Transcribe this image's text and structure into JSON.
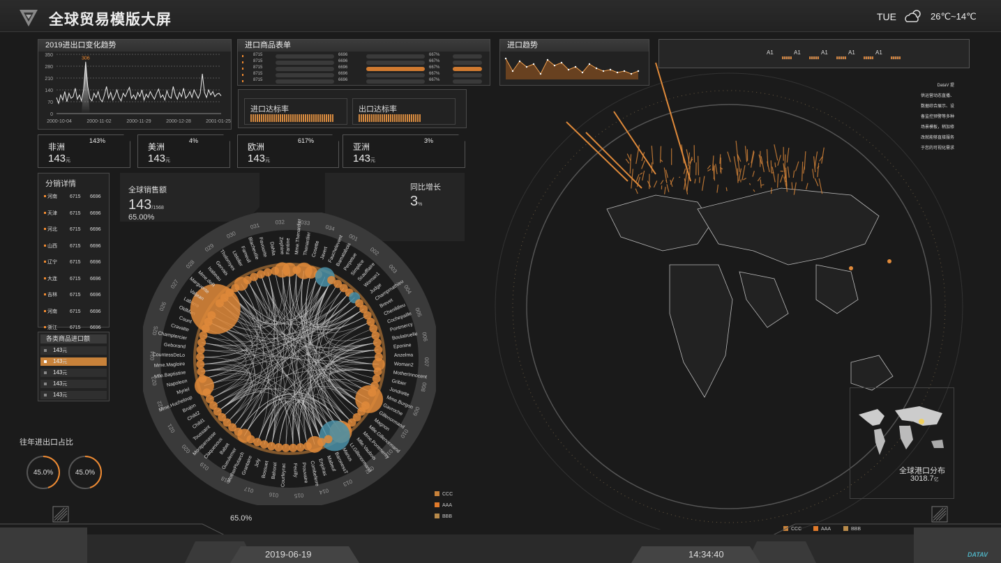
{
  "header": {
    "title": "全球贸易模版大屏",
    "weekday": "TUE",
    "temperature": "26℃~14℃"
  },
  "trend_panel": {
    "title": "2019进出口变化趋势",
    "peak_label": "306",
    "y_ticks": [
      "350",
      "280",
      "210",
      "140",
      "70",
      "0"
    ],
    "x_ticks": [
      "2000-10-04",
      "2000-11-02",
      "2000-11-29",
      "2000-12-28",
      "2001-01-25"
    ]
  },
  "chart_data": {
    "type": "line",
    "title": "2019进出口变化趋势",
    "x": [
      "2000-10-04",
      "2000-11-02",
      "2000-11-29",
      "2000-12-28",
      "2001-01-25"
    ],
    "ylim": [
      0,
      350
    ],
    "series": [
      {
        "values": [
          95,
          60,
          110,
          80,
          130,
          70,
          120,
          90,
          100,
          150,
          85,
          110,
          75,
          140,
          306,
          160,
          90,
          75,
          120,
          95,
          130,
          85,
          70,
          110,
          160,
          90,
          125,
          80,
          105,
          140,
          95,
          75,
          120,
          100,
          130,
          155,
          90,
          110,
          85,
          125,
          100,
          140,
          80,
          115,
          95,
          130,
          105,
          85,
          120,
          145,
          95,
          110,
          80,
          135,
          100,
          90,
          160,
          110,
          85,
          125,
          100,
          150,
          90,
          105,
          130,
          95,
          140,
          115,
          90,
          120,
          235,
          125,
          95,
          140,
          110,
          130,
          100,
          115,
          120,
          105
        ]
      }
    ]
  },
  "import_table": {
    "title": "进口商品表单",
    "rows": [
      {
        "a": "8715",
        "b": "6696",
        "c": "667%"
      },
      {
        "a": "8715",
        "b": "6696",
        "c": "667%"
      },
      {
        "a": "8715",
        "b": "6696",
        "c": "667%"
      },
      {
        "a": "8715",
        "b": "6696",
        "c": "667%"
      },
      {
        "a": "8715",
        "b": "6696",
        "c": "667%"
      }
    ]
  },
  "import_trend": {
    "title": "进口趋势"
  },
  "rates": {
    "import_label": "进口达标率",
    "export_label": "出口达标率"
  },
  "continents": [
    {
      "name": "非洲",
      "pct": "143%",
      "value": "143",
      "unit": "元"
    },
    {
      "name": "美洲",
      "pct": "4%",
      "value": "143",
      "unit": "元"
    },
    {
      "name": "欧洲",
      "pct": "617%",
      "value": "143",
      "unit": "元"
    },
    {
      "name": "亚洲",
      "pct": "3%",
      "value": "143",
      "unit": "元"
    }
  ],
  "distribution": {
    "title": "分销详情",
    "rows": [
      {
        "region": "河南",
        "a": "6715",
        "b": "6696"
      },
      {
        "region": "天津",
        "a": "6715",
        "b": "6696"
      },
      {
        "region": "河北",
        "a": "6715",
        "b": "6696"
      },
      {
        "region": "山西",
        "a": "6715",
        "b": "6696"
      },
      {
        "region": "辽宁",
        "a": "6715",
        "b": "6696"
      },
      {
        "region": "大连",
        "a": "6715",
        "b": "6696"
      },
      {
        "region": "吉林",
        "a": "6715",
        "b": "6696"
      },
      {
        "region": "河南",
        "a": "6715",
        "b": "6696"
      },
      {
        "region": "浙江",
        "a": "6715",
        "b": "6696"
      }
    ]
  },
  "import_amount": {
    "title": "各类商品进口额",
    "items": [
      {
        "value": "143",
        "unit": "元"
      },
      {
        "value": "143",
        "unit": "元"
      },
      {
        "value": "143",
        "unit": "元"
      },
      {
        "value": "143",
        "unit": "元"
      },
      {
        "value": "143",
        "unit": "元"
      }
    ],
    "active_index": 1
  },
  "sales": {
    "label": "全球销售额",
    "value": "143",
    "suffix": "/1568",
    "pct": "65.00%"
  },
  "yoy": {
    "label": "同比增长",
    "value": "3",
    "unit": "%"
  },
  "ratio": {
    "title": "往年进出口占比",
    "left": "45.0%",
    "right": "45.0%",
    "progress": 0.45
  },
  "bottom_pct": "65.0%",
  "chord": {
    "names": [
      "Fantine",
      "Mme.Thenardier",
      "Thenardier",
      "Cosette",
      "Javert",
      "Fauchelevent",
      "Bamatabois",
      "Perpetue",
      "Simplice",
      "Scaufflaire",
      "Woman1",
      "Judge",
      "Champmathieu",
      "Brevet",
      "Chenildieu",
      "Cochepaille",
      "Pontmercy",
      "Boulatruelle",
      "Eponine",
      "Anzelma",
      "Woman2",
      "MotherInnocent",
      "Gribier",
      "Jondrette",
      "Mme.Burgon",
      "Gavroche",
      "Gillenormand",
      "Magnon",
      "Mlle.Gillenormand",
      "Mme.Pontmercy",
      "Mlle.Vaubois",
      "Lt.Gillenormand",
      "Marius",
      "BaronessT",
      "Mabeuf",
      "Enjolras",
      "Combeferre",
      "Prouvaire",
      "Feuilly",
      "Courfeyrac",
      "Bahorel",
      "Bossuet",
      "Joly",
      "Grantaire",
      "MotherPlutarch",
      "Gueulemer",
      "Babet",
      "Claquesous",
      "Montparnasse",
      "Toussaint",
      "Child1",
      "Child2",
      "Brujon",
      "Mme.Hucheloup",
      "Myriel",
      "Napoleon",
      "Mlle.Baptistine",
      "Mme.Magloire",
      "CountessDeLo",
      "Geborand",
      "Champtercier",
      "Cravatte",
      "Count",
      "OldMan",
      "Labarre",
      "Valjean",
      "Marguerite",
      "Mme.deR",
      "Isabeau",
      "Gervais",
      "Tholomyes",
      "Listolier",
      "Fameuil",
      "Blacheville",
      "Favourite",
      "Dahlia",
      "Zephine"
    ],
    "numbers": [
      "001",
      "002",
      "003",
      "004",
      "005",
      "006",
      "007",
      "008",
      "009",
      "010",
      "011",
      "012",
      "013",
      "014",
      "015",
      "016",
      "017",
      "018",
      "019",
      "020",
      "021",
      "022",
      "023",
      "024",
      "025",
      "026",
      "027",
      "028",
      "029",
      "030",
      "031",
      "032",
      "033",
      "034"
    ],
    "legend": [
      {
        "label": "CCC",
        "color": "#c8823a"
      },
      {
        "label": "AAA",
        "color": "#e07a2a"
      },
      {
        "label": "BBB",
        "color": "#b88a4a"
      }
    ]
  },
  "right_info": {
    "a1_labels": [
      "A1",
      "A1",
      "A1",
      "A1",
      "A1"
    ],
    "lines": [
      "DataV 提",
      "供运营动态直播、",
      "数据综合展示、设",
      "备监控预警等多种",
      "场景模板，稍加修",
      "改就能够直接服务",
      "于您的可视化需求"
    ]
  },
  "port": {
    "label": "全球港口分布",
    "value": "3018.7",
    "unit": "亿"
  },
  "globe_legend": [
    {
      "label": "CCC",
      "color": "#c8823a"
    },
    {
      "label": "AAA",
      "color": "#e07a2a"
    },
    {
      "label": "BBB",
      "color": "#b88a4a"
    }
  ],
  "footer": {
    "date": "2019-06-19",
    "time": "14:34:40",
    "brand": "DATAV"
  }
}
